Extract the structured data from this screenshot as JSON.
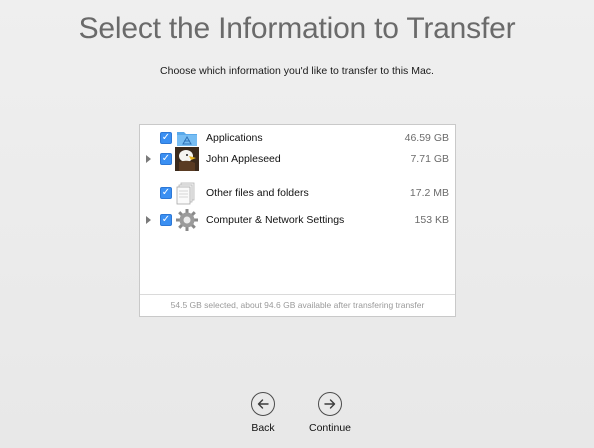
{
  "header": {
    "title": "Select the Information to Transfer",
    "subtitle": "Choose which information you'd like to transfer to this Mac."
  },
  "items": [
    {
      "label": "Applications",
      "size": "46.59 GB",
      "checked": true,
      "expandable": false,
      "icon": "applications-folder-icon"
    },
    {
      "label": "John Appleseed",
      "size": "7.71 GB",
      "checked": true,
      "expandable": true,
      "icon": "eagle-avatar-icon"
    },
    {
      "label": "Other files and folders",
      "size": "17.2 MB",
      "checked": true,
      "expandable": false,
      "icon": "documents-icon"
    },
    {
      "label": "Computer & Network Settings",
      "size": "153 KB",
      "checked": true,
      "expandable": true,
      "icon": "gear-icon"
    }
  ],
  "footer": {
    "status": "54.5 GB selected, about 94.6 GB available after transfering transfer"
  },
  "nav": {
    "back_label": "Back",
    "continue_label": "Continue"
  },
  "colors": {
    "checkbox": "#3a8ff2",
    "title": "#6a6a6a"
  }
}
